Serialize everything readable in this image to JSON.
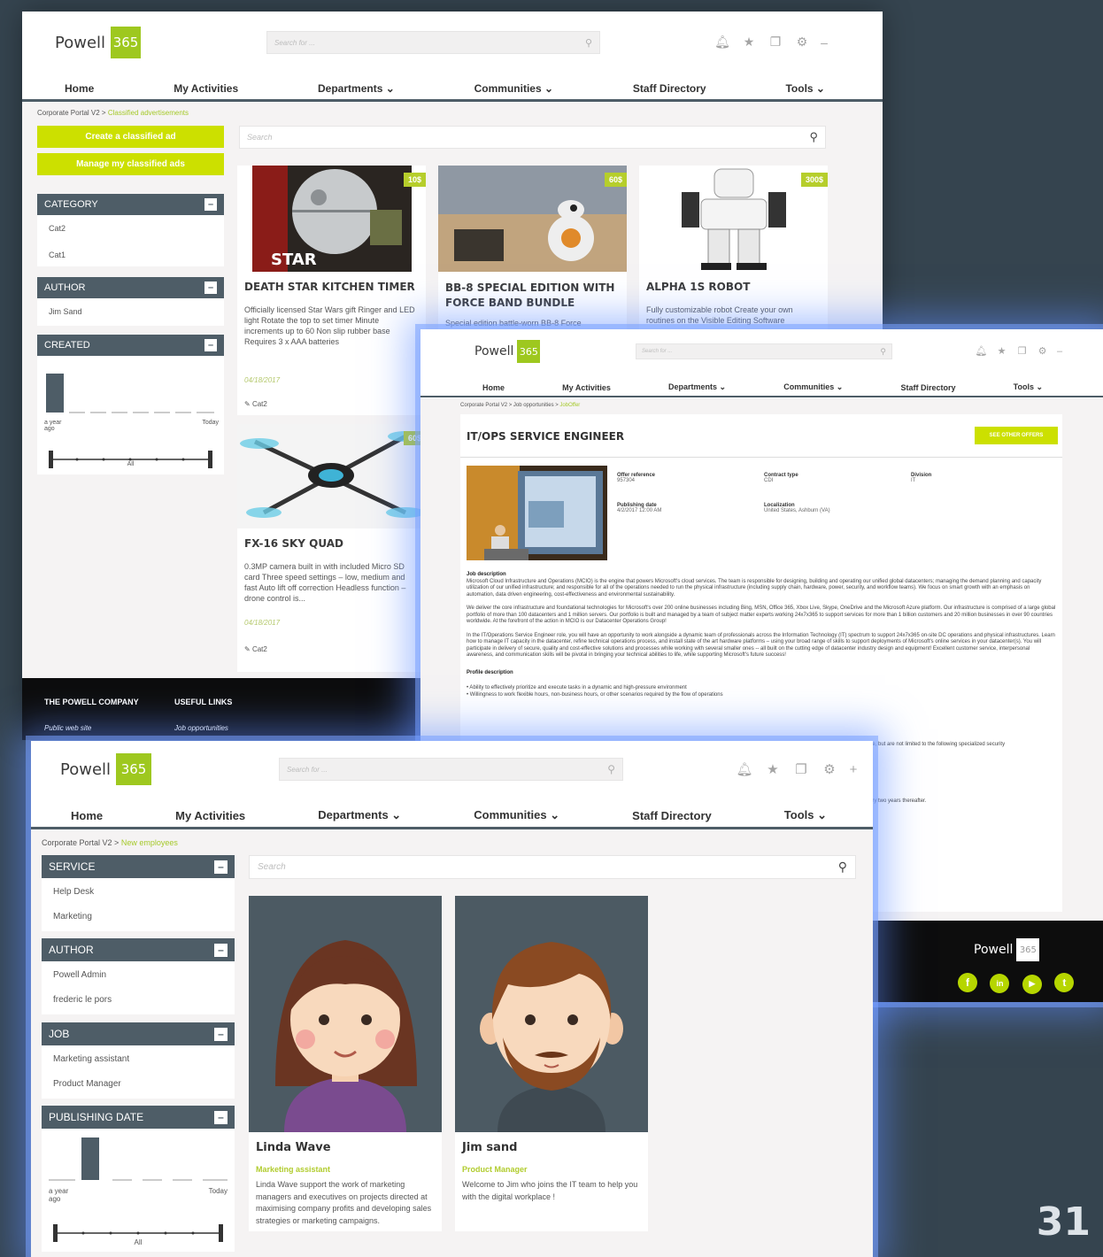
{
  "page_number": "31",
  "header": {
    "logo_word": "Powell",
    "logo_badge": "365",
    "search_placeholder": "Search for ...",
    "nav": [
      "Home",
      "My Activities",
      "Departments ⌄",
      "Communities ⌄",
      "Staff Directory",
      "Tools ⌄"
    ]
  },
  "win_classified": {
    "breadcrumb_root": "Corporate Portal V2 >",
    "breadcrumb_current": "Classified advertisements",
    "create_btn": "Create a classified ad",
    "manage_btn": "Manage my classified ads",
    "search_placeholder": "Search",
    "filters": [
      {
        "title": "CATEGORY",
        "items": [
          "Cat2",
          "Cat1"
        ]
      },
      {
        "title": "AUTHOR",
        "items": [
          "Jim Sand"
        ]
      },
      {
        "title": "CREATED",
        "items": []
      }
    ],
    "hist_left": "a year ago",
    "hist_right": "Today",
    "hist_all": "All",
    "cards": [
      {
        "price": "10$",
        "title": "DEATH STAR KITCHEN TIMER",
        "desc": "Officially licensed Star Wars gift Ringer and LED light Rotate the top to set timer Minute increments up to 60 Non slip rubber base Requires 3 x AAA batteries",
        "date": "04/18/2017",
        "cat": "Cat2"
      },
      {
        "price": "60$",
        "title": "BB-8 SPECIAL EDITION WITH FORCE BAND BUNDLE",
        "desc": "Special edition battle-worn BB-8 Force",
        "date": "",
        "cat": ""
      },
      {
        "price": "300$",
        "title": "ALPHA 1S ROBOT",
        "desc": "Fully customizable robot Create your own routines on the Visible Editing Software",
        "date": "",
        "cat": ""
      },
      {
        "price": "60$",
        "title": "FX-16 SKY QUAD",
        "desc": "0.3MP camera built in with included Micro SD card Three speed settings – low, medium and fast Auto lift off correction Headless function – drone control is...",
        "date": "04/18/2017",
        "cat": "Cat2"
      }
    ],
    "footer_cols": [
      {
        "title": "THE POWELL COMPANY",
        "link": "Public web site"
      },
      {
        "title": "USEFUL LINKS",
        "link": "Job opportunities"
      }
    ]
  },
  "win_job": {
    "breadcrumb": "Corporate Portal V2 > Job opportunities > ",
    "breadcrumb_current": "JobOffer",
    "title": "IT/OPS SERVICE ENGINEER",
    "see_other": "SEE OTHER OFFERS",
    "fields": [
      {
        "label": "Offer reference",
        "value": "957304"
      },
      {
        "label": "Contract type",
        "value": "CDI"
      },
      {
        "label": "Division",
        "value": "IT"
      },
      {
        "label": "Publishing date",
        "value": "4/2/2017 12:00 AM"
      },
      {
        "label": "Localization",
        "value": "United States, Ashburn (VA)"
      }
    ],
    "job_desc_title": "Job description",
    "job_desc_p1": "Microsoft Cloud Infrastructure and Operations (MCIO) is the engine that powers Microsoft's cloud services. The team is responsible for designing, building and operating our unified global datacenters; managing the demand planning and capacity utilization of our unified infrastructure; and responsible for all of the operations needed to run the physical infrastructure (including supply chain, hardware, power, security, and workflow teams). We focus on smart growth with an emphasis on automation, data driven engineering, cost-effectiveness and environmental sustainability.",
    "job_desc_p2": "We deliver the core infrastructure and foundational technologies for Microsoft's over 200 online businesses including Bing, MSN, Office 365, Xbox Live, Skype, OneDrive and the Microsoft Azure platform. Our infrastructure is comprised of a large global portfolio of more than 100 datacenters and 1 million servers. Our portfolio is built and managed by a team of subject matter experts working 24x7x365 to support services for more than 1 billion customers and 20 million businesses in over 90 countries worldwide. At the forefront of the action in MCIO is our Datacenter Operations Group!",
    "job_desc_p3": "In the IT/Operations Service Engineer role, you will have an opportunity to work alongside a dynamic team of professionals across the Information Technology (IT) spectrum to support 24x7x365 on-site DC operations and physical infrastructures. Learn how to manage IT capacity in the datacenter, refine technical operations process, and install state of the art hardware platforms – using your broad range of skills to support deployments of Microsoft's online services in your datacenter(s). You will participate in delivery of secure, quality and cost-effective solutions and processes while working with several smaller ones -- all built on the cutting edge of datacenter industry design and equipment! Excellent customer service, interpersonal awareness, and communication skills will be pivotal in bringing your technical abilities to life, while supporting Microsoft's future success!",
    "profile_title": "Profile description",
    "profile_items": [
      "• Ability to effectively prioritize and execute tasks in a dynamic and high-pressure environment",
      "• Willingness to work flexible hours, non-business hours, or other scenarios required by the flow of operations"
    ],
    "partial_1": "de, but are not limited to the following specialized security",
    "partial_2": "ery two years thereafter.",
    "footer_logo_word": "Powell",
    "footer_logo_badge": "365",
    "social": [
      "f",
      "in",
      "▶",
      "t"
    ]
  },
  "win_people": {
    "breadcrumb_root": "Corporate Portal V2 >",
    "breadcrumb_current": "New employees",
    "search_placeholder": "Search",
    "filters": [
      {
        "title": "SERVICE",
        "items": [
          "Help Desk",
          "Marketing"
        ]
      },
      {
        "title": "AUTHOR",
        "items": [
          "Powell Admin",
          "frederic le pors"
        ]
      },
      {
        "title": "JOB",
        "items": [
          "Marketing assistant",
          "Product Manager"
        ]
      },
      {
        "title": "PUBLISHING DATE",
        "items": []
      }
    ],
    "hist_left": "a year ago",
    "hist_right": "Today",
    "hist_all": "All",
    "people": [
      {
        "name": "Linda Wave",
        "role": "Marketing assistant",
        "bio": "Linda Wave support the work of marketing managers and executives on projects directed at maximising company profits and developing sales strategies or marketing campaigns."
      },
      {
        "name": "Jim sand",
        "role": "Product Manager",
        "bio": "Welcome to Jim who joins the IT team to help you with the digital workplace !"
      }
    ]
  }
}
